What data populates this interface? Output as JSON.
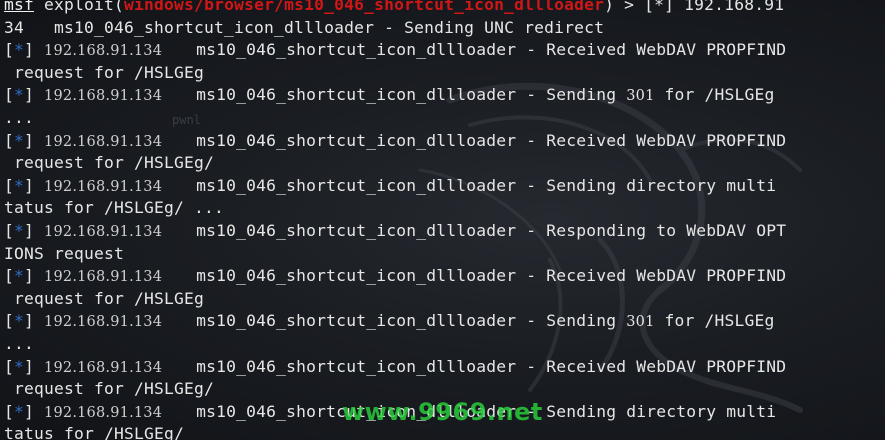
{
  "prompt": {
    "msf": "msf",
    "exploit_prefix": " exploit(",
    "module": "windows/browser/ms10_046_shortcut_icon_dllloader",
    "exploit_suffix": ") > "
  },
  "bg_label": "pwnl",
  "watermark_text": "www.9969.net",
  "colors": {
    "background": "#1a1d22",
    "text": "#e6e6e6",
    "module_red": "#d01616",
    "status_blue": "#2f6ec7",
    "watermark_green": "#28d23c"
  },
  "lines": [
    {
      "type": "prompt",
      "rest": "[*] 192.168.91"
    },
    {
      "type": "plain",
      "text": "34   ms10_046_shortcut_icon_dllloader - Sending UNC redirect"
    },
    {
      "type": "status",
      "ip": "192.168.91.134",
      "msg": "ms10_046_shortcut_icon_dllloader - Received WebDAV PROPFIND"
    },
    {
      "type": "plain",
      "text": " request for /HSLGEg"
    },
    {
      "type": "status301",
      "ip": "192.168.91.134",
      "msg_pre": "ms10_046_shortcut_icon_dllloader - Sending ",
      "num": "301",
      "msg_post": " for /HSLGEg"
    },
    {
      "type": "plain",
      "text": "..."
    },
    {
      "type": "status",
      "ip": "192.168.91.134",
      "msg": "ms10_046_shortcut_icon_dllloader - Received WebDAV PROPFIND"
    },
    {
      "type": "plain",
      "text": " request for /HSLGEg/"
    },
    {
      "type": "status",
      "ip": "192.168.91.134",
      "msg": "ms10_046_shortcut_icon_dllloader - Sending directory multi"
    },
    {
      "type": "plain",
      "text": "tatus for /HSLGEg/ ..."
    },
    {
      "type": "status",
      "ip": "192.168.91.134",
      "msg": "ms10_046_shortcut_icon_dllloader - Responding to WebDAV OPT"
    },
    {
      "type": "plain",
      "text": "IONS request"
    },
    {
      "type": "status",
      "ip": "192.168.91.134",
      "msg": "ms10_046_shortcut_icon_dllloader - Received WebDAV PROPFIND"
    },
    {
      "type": "plain",
      "text": " request for /HSLGEg"
    },
    {
      "type": "status301",
      "ip": "192.168.91.134",
      "msg_pre": "ms10_046_shortcut_icon_dllloader - Sending ",
      "num": "301",
      "msg_post": " for /HSLGEg"
    },
    {
      "type": "plain",
      "text": "..."
    },
    {
      "type": "status",
      "ip": "192.168.91.134",
      "msg": "ms10_046_shortcut_icon_dllloader - Received WebDAV PROPFIND"
    },
    {
      "type": "plain",
      "text": " request for /HSLGEg/"
    },
    {
      "type": "status",
      "ip": "192.168.91.134",
      "msg": "ms10_046_shortcut_icon_dllloader - Sending directory multi"
    },
    {
      "type": "plain",
      "text": "tatus for /HSLGEg/"
    }
  ]
}
